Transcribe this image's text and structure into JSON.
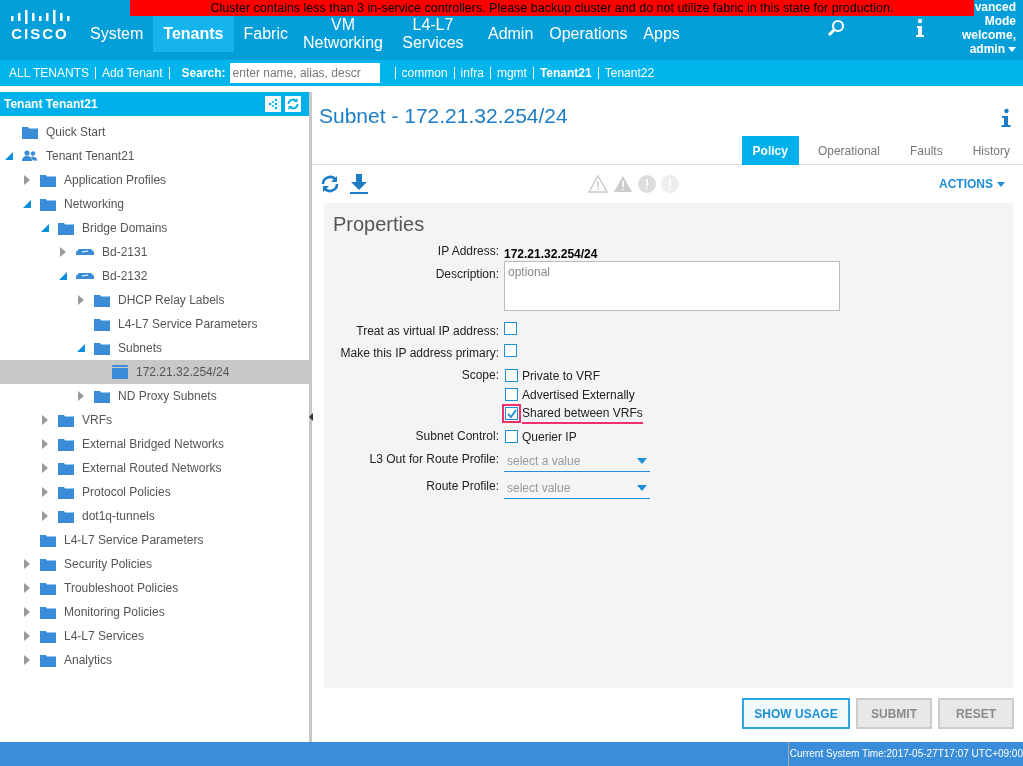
{
  "banner": "Cluster contains less than 3 in-service controllers. Please backup cluster and do not utilize fabric in this state for production.",
  "nav": {
    "logo_text": "CISCO",
    "tabs": [
      {
        "label": "System",
        "selected": false
      },
      {
        "label": "Tenants",
        "selected": true
      },
      {
        "label": "Fabric",
        "selected": false
      },
      {
        "label": "VM Networking",
        "selected": false
      },
      {
        "label": "L4-L7 Services",
        "selected": false
      },
      {
        "label": "Admin",
        "selected": false
      },
      {
        "label": "Operations",
        "selected": false
      },
      {
        "label": "Apps",
        "selected": false
      }
    ],
    "user_lines": [
      "vanced",
      "Mode",
      "welcome,"
    ],
    "user": "admin"
  },
  "subnav": {
    "links": [
      "ALL TENANTS",
      "Add Tenant"
    ],
    "search_label": "Search:",
    "search_placeholder": "enter name, alias, descr",
    "tenants": [
      "common",
      "infra",
      "mgmt",
      "Tenant21",
      "Tenant22"
    ]
  },
  "sidebar": {
    "title": "Tenant Tenant21",
    "tree": [
      {
        "label": "Quick Start",
        "kind": "folder",
        "selected": false
      },
      {
        "label": "Tenant Tenant21",
        "kind": "tenant",
        "expanded": true,
        "selected": false,
        "children": [
          {
            "label": "Application Profiles",
            "kind": "folder",
            "expanded": false,
            "selected": false
          },
          {
            "label": "Networking",
            "kind": "folder",
            "expanded": true,
            "selected": false,
            "children": [
              {
                "label": "Bridge Domains",
                "kind": "folder",
                "expanded": true,
                "selected": false,
                "children": [
                  {
                    "label": "Bd-2131",
                    "kind": "bridge-domain",
                    "expanded": false,
                    "selected": false
                  },
                  {
                    "label": "Bd-2132",
                    "kind": "bridge-domain",
                    "expanded": true,
                    "selected": false,
                    "children": [
                      {
                        "label": "DHCP Relay Labels",
                        "kind": "folder",
                        "expanded": false,
                        "selected": false
                      },
                      {
                        "label": "L4-L7 Service Parameters",
                        "kind": "folder",
                        "selected": false
                      },
                      {
                        "label": "Subnets",
                        "kind": "folder",
                        "expanded": true,
                        "selected": false,
                        "children": [
                          {
                            "label": "172.21.32.254/24",
                            "kind": "subnet",
                            "selected": true
                          }
                        ]
                      },
                      {
                        "label": "ND Proxy Subnets",
                        "kind": "folder",
                        "expanded": false,
                        "selected": false
                      }
                    ]
                  }
                ]
              },
              {
                "label": "VRFs",
                "kind": "folder",
                "expanded": false,
                "selected": false
              },
              {
                "label": "External Bridged Networks",
                "kind": "folder",
                "expanded": false,
                "selected": false
              },
              {
                "label": "External Routed Networks",
                "kind": "folder",
                "expanded": false,
                "selected": false
              },
              {
                "label": "Protocol Policies",
                "kind": "folder",
                "expanded": false,
                "selected": false
              },
              {
                "label": "dot1q-tunnels",
                "kind": "folder",
                "expanded": false,
                "selected": false
              }
            ]
          },
          {
            "label": "L4-L7 Service Parameters",
            "kind": "folder",
            "selected": false
          },
          {
            "label": "Security Policies",
            "kind": "folder",
            "expanded": false,
            "selected": false
          },
          {
            "label": "Troubleshoot Policies",
            "kind": "folder",
            "expanded": false,
            "selected": false
          },
          {
            "label": "Monitoring Policies",
            "kind": "folder",
            "expanded": false,
            "selected": false
          },
          {
            "label": "L4-L7 Services",
            "kind": "folder",
            "expanded": false,
            "selected": false
          },
          {
            "label": "Analytics",
            "kind": "folder",
            "expanded": false,
            "selected": false
          }
        ]
      }
    ]
  },
  "content": {
    "title": "Subnet - 172.21.32.254/24",
    "tabs": [
      {
        "label": "Policy",
        "selected": true
      },
      {
        "label": "Operational",
        "selected": false
      },
      {
        "label": "Faults",
        "selected": false
      },
      {
        "label": "History",
        "selected": false
      }
    ],
    "actions": "ACTIONS",
    "properties": {
      "heading": "Properties",
      "fields": [
        {
          "kind": "value",
          "label": "IP Address:",
          "value": "172.21.32.254/24"
        },
        {
          "kind": "textarea",
          "label": "Description:",
          "placeholder": "optional"
        },
        {
          "kind": "checkbox",
          "label": "Treat as virtual IP address:",
          "checked": false
        },
        {
          "kind": "checkbox",
          "label": "Make this IP address primary:",
          "checked": false
        },
        {
          "kind": "options",
          "label": "Scope:",
          "options": [
            {
              "label": "Private to VRF",
              "checked": false,
              "highlighted": false
            },
            {
              "label": "Advertised Externally",
              "checked": false,
              "highlighted": false
            },
            {
              "label": "Shared between VRFs",
              "checked": true,
              "highlighted": true
            }
          ]
        },
        {
          "kind": "options",
          "label": "Subnet Control:",
          "options": [
            {
              "label": "Querier IP",
              "checked": false,
              "highlighted": false
            }
          ]
        },
        {
          "kind": "select",
          "label": "L3 Out for Route Profile:",
          "placeholder": "select a value"
        },
        {
          "kind": "select",
          "label": "Route Profile:",
          "placeholder": "select value"
        }
      ]
    },
    "buttons": [
      {
        "label": "SHOW USAGE",
        "disabled": false
      },
      {
        "label": "SUBMIT",
        "disabled": true
      },
      {
        "label": "RESET",
        "disabled": true
      }
    ]
  },
  "status_bar": "Current System Time:2017-05-27T17:07 UTC+09:00"
}
